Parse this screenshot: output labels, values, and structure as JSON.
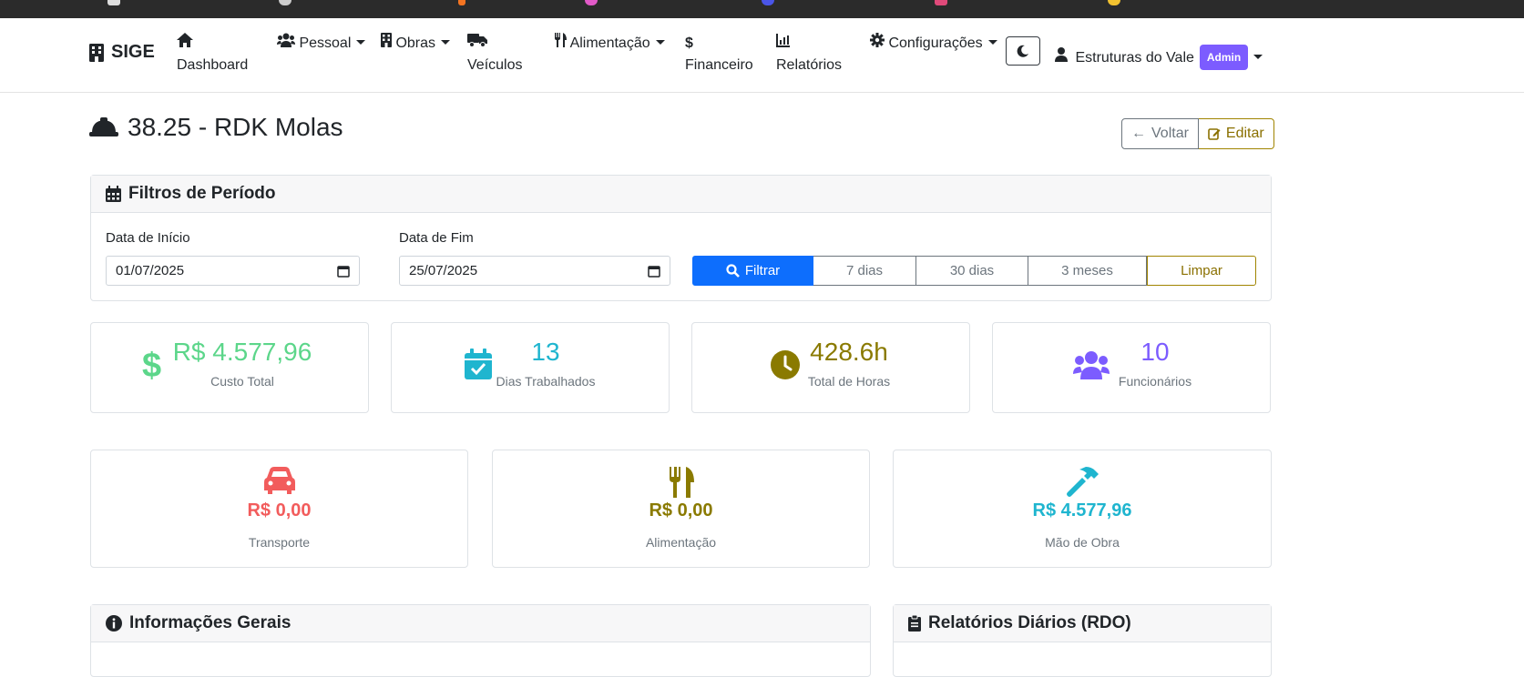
{
  "navbar": {
    "brand": "SIGE",
    "items": [
      {
        "label": "Dashboard",
        "icon": "home-icon",
        "dropdown": false
      },
      {
        "label": "Pessoal",
        "icon": "users-icon",
        "dropdown": true
      },
      {
        "label": "Obras",
        "icon": "building-icon",
        "dropdown": true
      },
      {
        "label": "Veículos",
        "icon": "truck-icon",
        "dropdown": false
      },
      {
        "label": "Alimentação",
        "icon": "utensils-icon",
        "dropdown": true
      },
      {
        "label": "Financeiro",
        "icon": "dollar-icon",
        "dropdown": false
      },
      {
        "label": "Relatórios",
        "icon": "chart-icon",
        "dropdown": false
      },
      {
        "label": "Configurações",
        "icon": "gear-icon",
        "dropdown": true
      }
    ],
    "user": {
      "name": "Estruturas do Vale",
      "role_badge": "Admin"
    }
  },
  "page": {
    "title": "38.25 - RDK Molas",
    "back_label": "Voltar",
    "edit_label": "Editar"
  },
  "filters": {
    "header": "Filtros de Período",
    "start_label": "Data de Início",
    "start_value": "01/07/2025",
    "end_label": "Data de Fim",
    "end_value": "25/07/2025",
    "filter_button": "Filtrar",
    "quick": [
      "7 dias",
      "30 dias",
      "3 meses"
    ],
    "clear_button": "Limpar"
  },
  "stats": [
    {
      "value": "R$ 4.577,96",
      "label": "Custo Total",
      "color": "#5cd68a",
      "icon": "dollar-icon"
    },
    {
      "value": "13",
      "label": "Dias Trabalhados",
      "color": "#1fb5cf",
      "icon": "calendar-check-icon"
    },
    {
      "value": "428.6h",
      "label": "Total de Horas",
      "color": "#8a7a00",
      "icon": "clock-icon"
    },
    {
      "value": "10",
      "label": "Funcionários",
      "color": "#7c5cff",
      "icon": "users-icon"
    }
  ],
  "costs": [
    {
      "value": "R$ 0,00",
      "label": "Transporte",
      "color": "#f25c5c",
      "icon": "car-icon"
    },
    {
      "value": "R$ 0,00",
      "label": "Alimentação",
      "color": "#8a7a00",
      "icon": "utensils-icon"
    },
    {
      "value": "R$ 4.577,96",
      "label": "Mão de Obra",
      "color": "#1fb5cf",
      "icon": "hammer-icon"
    }
  ],
  "sections": {
    "info": "Informações Gerais",
    "rdo": "Relatórios Diários (RDO)"
  }
}
